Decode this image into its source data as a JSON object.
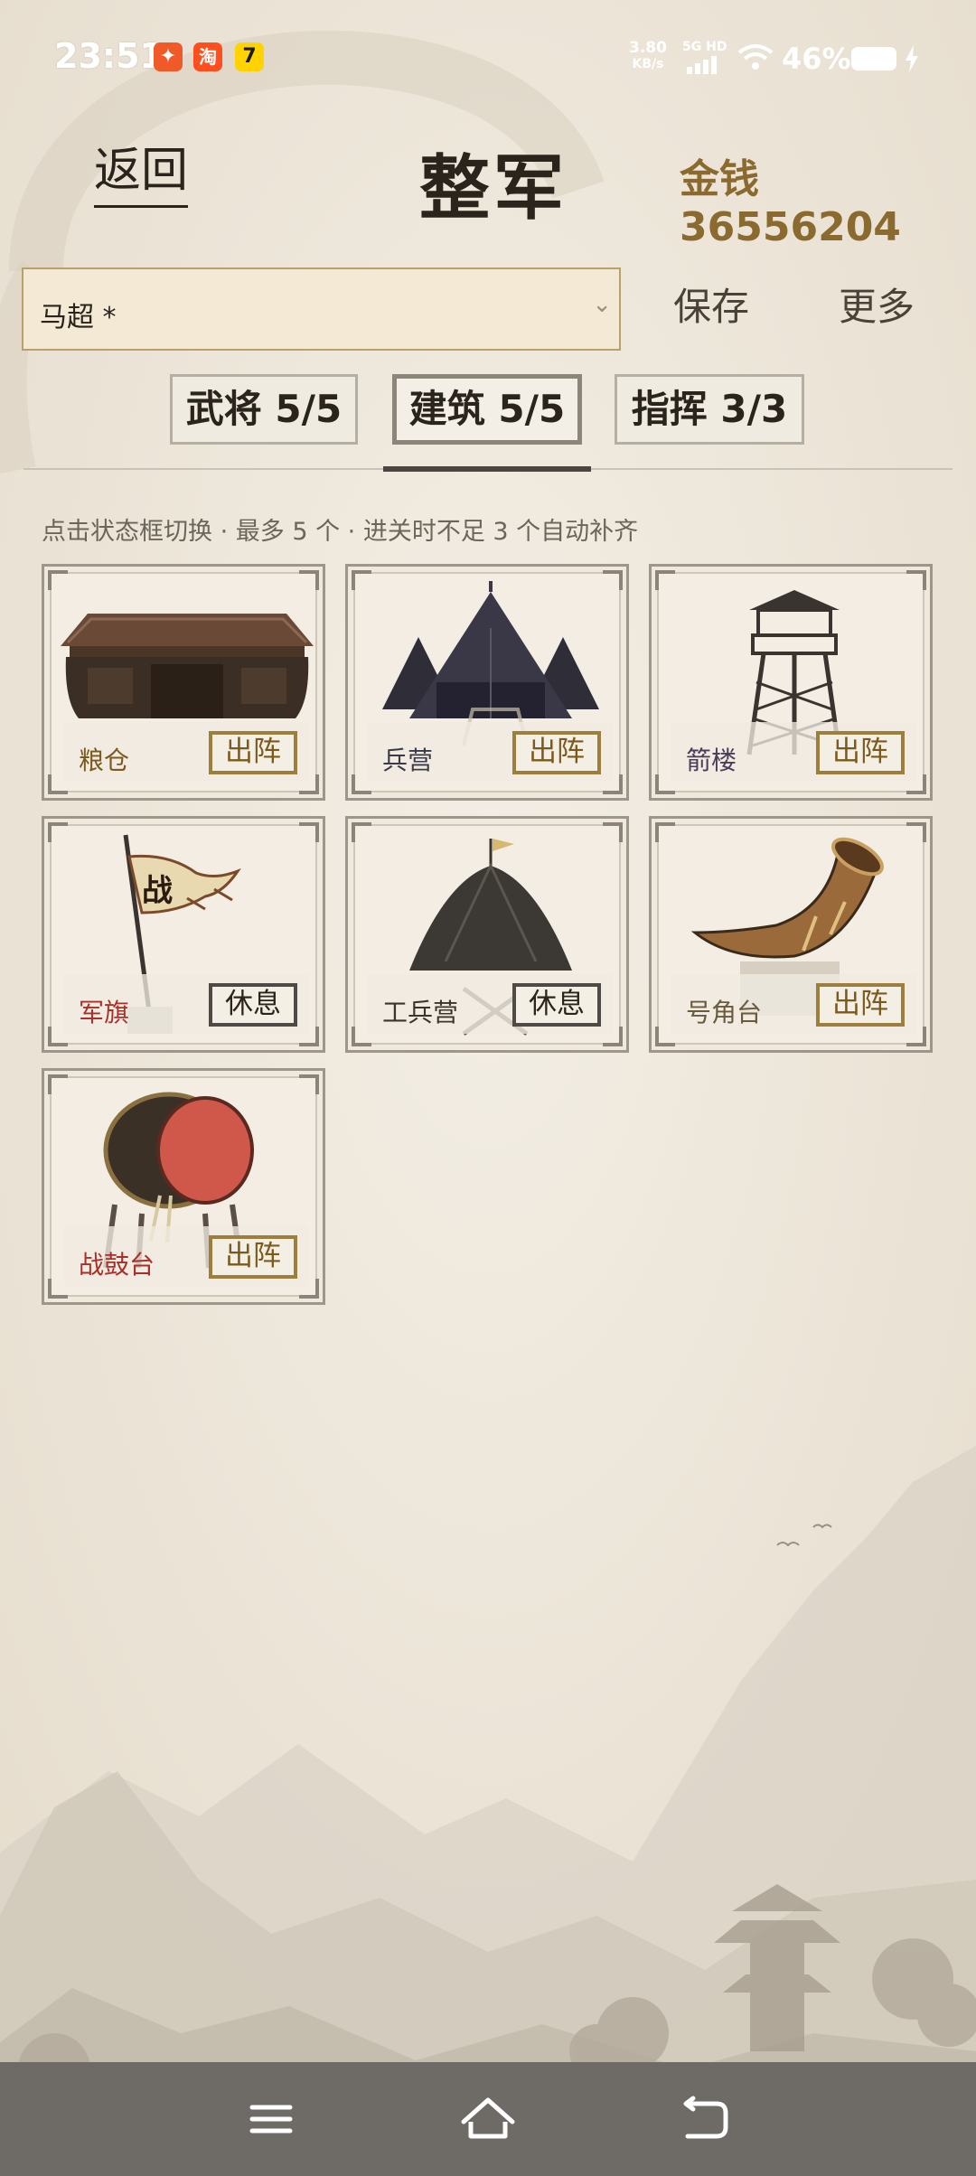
{
  "status_bar": {
    "time": "23:51",
    "app_icons": [
      {
        "name": "app-icon-orange",
        "glyph": "✦",
        "color": "#f05a28"
      },
      {
        "name": "taobao-icon",
        "glyph": "淘",
        "color": "#ff4f1f"
      },
      {
        "name": "app-icon-seven",
        "glyph": "7",
        "color": "#ffd200"
      }
    ],
    "speed_value": "3.80",
    "speed_unit": "KB/s",
    "network": "5G HD",
    "battery": "46%"
  },
  "header": {
    "back_label": "返回",
    "title": "整军",
    "money_label": "金钱",
    "money_value": "36556204"
  },
  "selector": {
    "value": "马超 *",
    "save_label": "保存",
    "more_label": "更多"
  },
  "tabs": [
    {
      "label": "武将 5/5",
      "active": false
    },
    {
      "label": "建筑 5/5",
      "active": true
    },
    {
      "label": "指挥 3/3",
      "active": false
    }
  ],
  "hint": "点击状态框切换 · 最多 5 个 · 进关时不足 3 个自动补齐",
  "buildings": [
    {
      "name": "粮仓",
      "status": "出阵",
      "name_color": "#7a5a1e",
      "icon": "granary-icon"
    },
    {
      "name": "兵营",
      "status": "出阵",
      "name_color": "#3a3a48",
      "icon": "barracks-tent-icon"
    },
    {
      "name": "箭楼",
      "status": "出阵",
      "name_color": "#4a3e5a",
      "icon": "arrow-tower-icon"
    },
    {
      "name": "军旗",
      "status": "休息",
      "name_color": "#a8302a",
      "icon": "war-banner-icon"
    },
    {
      "name": "工兵营",
      "status": "休息",
      "name_color": "#3a342c",
      "icon": "engineer-tent-icon"
    },
    {
      "name": "号角台",
      "status": "出阵",
      "name_color": "#6a5a3e",
      "icon": "war-horn-icon"
    },
    {
      "name": "战鼓台",
      "status": "出阵",
      "name_color": "#a8302a",
      "icon": "war-drum-icon"
    }
  ],
  "banner_glyph": "战",
  "colors": {
    "accent_gold": "#8a6a2e",
    "deploy_border": "#9c7f3e",
    "rest_border": "#4f4a45",
    "background": "#efe9dd"
  }
}
